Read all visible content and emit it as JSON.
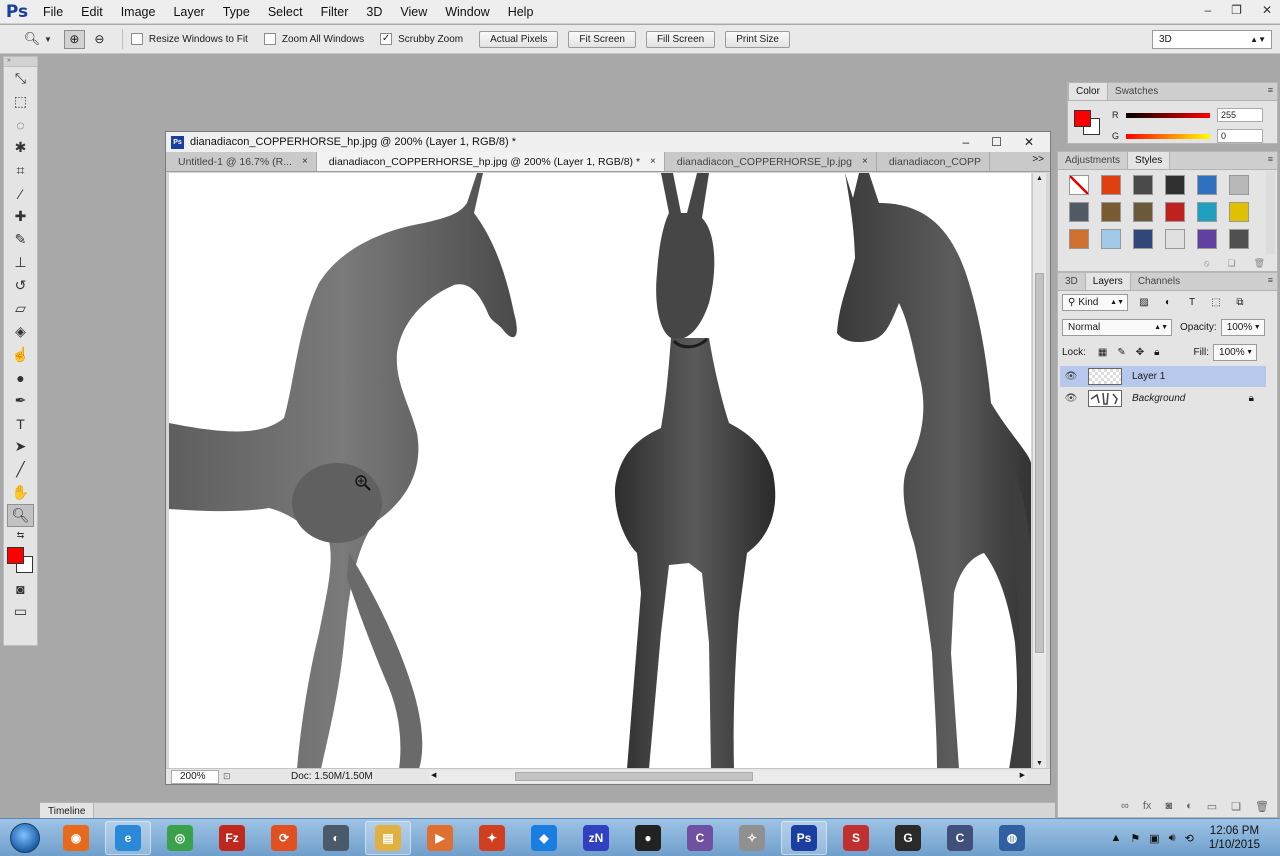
{
  "app": {
    "logo": "Ps",
    "menu": [
      "File",
      "Edit",
      "Image",
      "Layer",
      "Type",
      "Select",
      "Filter",
      "3D",
      "View",
      "Window",
      "Help"
    ],
    "window_controls": [
      "–",
      "❐",
      "✕"
    ]
  },
  "options_bar": {
    "tool_icon": "zoom-icon",
    "checkboxes": [
      {
        "label": "Resize Windows to Fit",
        "checked": false
      },
      {
        "label": "Zoom All Windows",
        "checked": false
      },
      {
        "label": "Scrubby Zoom",
        "checked": true
      }
    ],
    "buttons": [
      "Actual Pixels",
      "Fit Screen",
      "Fill Screen",
      "Print Size"
    ],
    "workspace": "3D"
  },
  "document": {
    "title": "dianadiacon_COPPERHORSE_hp.jpg @ 200% (Layer 1, RGB/8) *",
    "tabs": [
      {
        "label": "Untitled-1 @ 16.7% (R...",
        "active": false
      },
      {
        "label": "dianadiacon_COPPERHORSE_hp.jpg @ 200% (Layer 1, RGB/8) *",
        "active": true
      },
      {
        "label": "dianadiacon_COPPERHORSE_lp.jpg",
        "active": false
      },
      {
        "label": "dianadiacon_COPP",
        "active": false
      }
    ],
    "tabs_overflow": ">>",
    "zoom": "200%",
    "doc_info": "Doc: 1.50M/1.50M"
  },
  "color_panel": {
    "tabs": [
      "Color",
      "Swatches"
    ],
    "channels": [
      {
        "label": "R",
        "value": "255"
      },
      {
        "label": "G",
        "value": "0"
      }
    ],
    "foreground": "#ff0000"
  },
  "styles_panel": {
    "tabs": [
      "Adjustments",
      "Styles"
    ],
    "swatches": [
      "#ffffff",
      "#e04010",
      "#4a4a4a",
      "#303030",
      "#3070c0",
      "#b8b8b8",
      "#505a64",
      "#7a5a30",
      "#6a5a3a",
      "#c02020",
      "#20a0c0",
      "#e0c000",
      "#d07030",
      "#a0c8e8",
      "#304878",
      "#e0e0e0",
      "#6040a0",
      "#505050"
    ]
  },
  "layers_panel": {
    "tabs": [
      "3D",
      "Layers",
      "Channels"
    ],
    "filter": "Kind",
    "blend_mode": "Normal",
    "opacity_label": "Opacity:",
    "opacity": "100%",
    "lock_label": "Lock:",
    "fill_label": "Fill:",
    "fill": "100%",
    "layers": [
      {
        "name": "Layer 1",
        "selected": true,
        "locked": false
      },
      {
        "name": "Background",
        "selected": false,
        "locked": true
      }
    ]
  },
  "timeline": {
    "label": "Timeline"
  },
  "taskbar": {
    "apps": [
      {
        "name": "firefox-icon",
        "color": "#e66a1a",
        "glyph": "◉",
        "running": false
      },
      {
        "name": "internet-explorer-icon",
        "color": "#2a8ad8",
        "glyph": "e",
        "running": true
      },
      {
        "name": "chrome-icon",
        "color": "#3aa04a",
        "glyph": "◎",
        "running": false
      },
      {
        "name": "filezilla-icon",
        "color": "#c0281e",
        "glyph": "Fz",
        "running": false
      },
      {
        "name": "app-orange-icon",
        "color": "#e05020",
        "glyph": "⟳",
        "running": false
      },
      {
        "name": "app-dark-icon",
        "color": "#4a5a6a",
        "glyph": "◐",
        "running": false
      },
      {
        "name": "file-explorer-icon",
        "color": "#e0b040",
        "glyph": "▤",
        "running": true
      },
      {
        "name": "media-player-icon",
        "color": "#e07030",
        "glyph": "▶",
        "running": false
      },
      {
        "name": "app-red-icon",
        "color": "#d04020",
        "glyph": "✦",
        "running": false
      },
      {
        "name": "dropbox-icon",
        "color": "#1a7ee0",
        "glyph": "◆",
        "running": false
      },
      {
        "name": "app-zn-icon",
        "color": "#3040c0",
        "glyph": "zN",
        "running": false
      },
      {
        "name": "app-character-icon",
        "color": "#222222",
        "glyph": "●",
        "running": false
      },
      {
        "name": "app-purple-icon",
        "color": "#7050a0",
        "glyph": "C",
        "running": false
      },
      {
        "name": "app-figure-icon",
        "color": "#909090",
        "glyph": "✧",
        "running": false
      },
      {
        "name": "photoshop-icon",
        "color": "#1b3fa0",
        "glyph": "Ps",
        "running": true
      },
      {
        "name": "app-s-icon",
        "color": "#c03030",
        "glyph": "S",
        "running": false
      },
      {
        "name": "app-g-icon",
        "color": "#2a2a2a",
        "glyph": "G",
        "running": false
      },
      {
        "name": "app-c-icon",
        "color": "#40507a",
        "glyph": "C",
        "running": false
      },
      {
        "name": "app-sphere-icon",
        "color": "#3060a0",
        "glyph": "◍",
        "running": false
      }
    ],
    "time": "12:06 PM",
    "date": "1/10/2015"
  }
}
